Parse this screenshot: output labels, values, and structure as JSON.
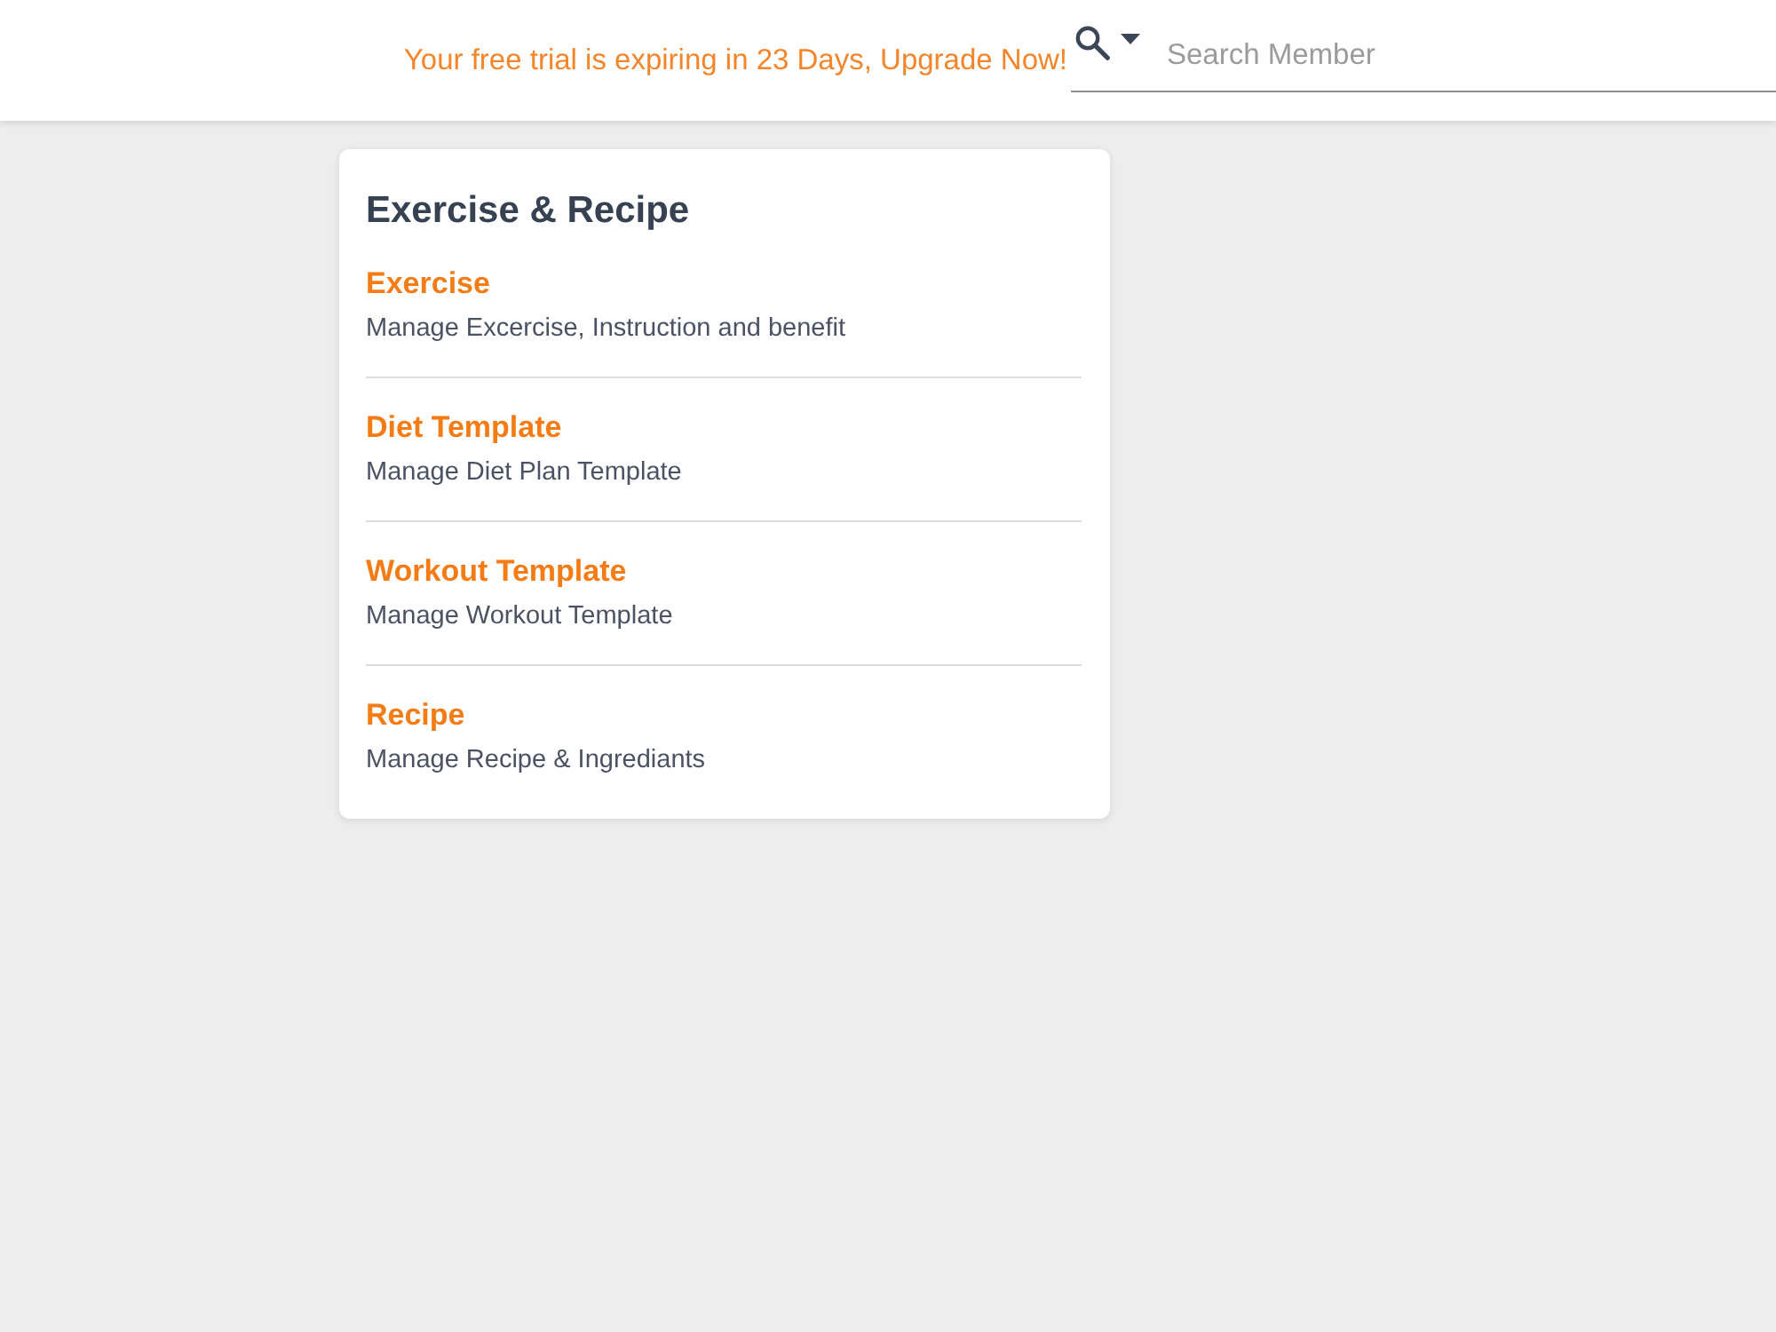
{
  "header": {
    "trial_notice": "Your free trial is expiring in 23 Days, Upgrade Now!",
    "search": {
      "placeholder": "Search Member"
    }
  },
  "card": {
    "title": "Exercise & Recipe",
    "items": [
      {
        "title": "Exercise",
        "description": "Manage Excercise, Instruction and benefit"
      },
      {
        "title": "Diet Template",
        "description": "Manage Diet Plan Template"
      },
      {
        "title": "Workout Template",
        "description": "Manage Workout Template"
      },
      {
        "title": "Recipe",
        "description": "Manage Recipe & Ingrediants"
      }
    ]
  }
}
